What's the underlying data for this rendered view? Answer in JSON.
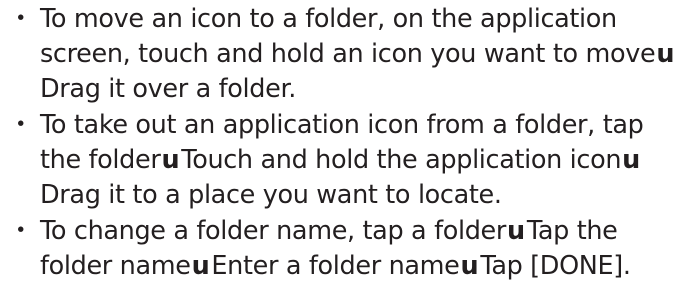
{
  "bullet_symbol": "・",
  "arrow_symbol": "u",
  "instructions": [
    {
      "parts": [
        "To move an icon to a folder, on the application screen, touch and hold an icon you want to move",
        "Drag it over a folder."
      ]
    },
    {
      "parts": [
        "To take out an application icon from a folder, tap the folder",
        "Touch and hold the application icon",
        "Drag it to a place you want to locate."
      ]
    },
    {
      "parts": [
        "To change a folder name, tap a folder",
        "Tap the folder name",
        "Enter a folder name",
        "Tap [DONE]."
      ]
    }
  ]
}
